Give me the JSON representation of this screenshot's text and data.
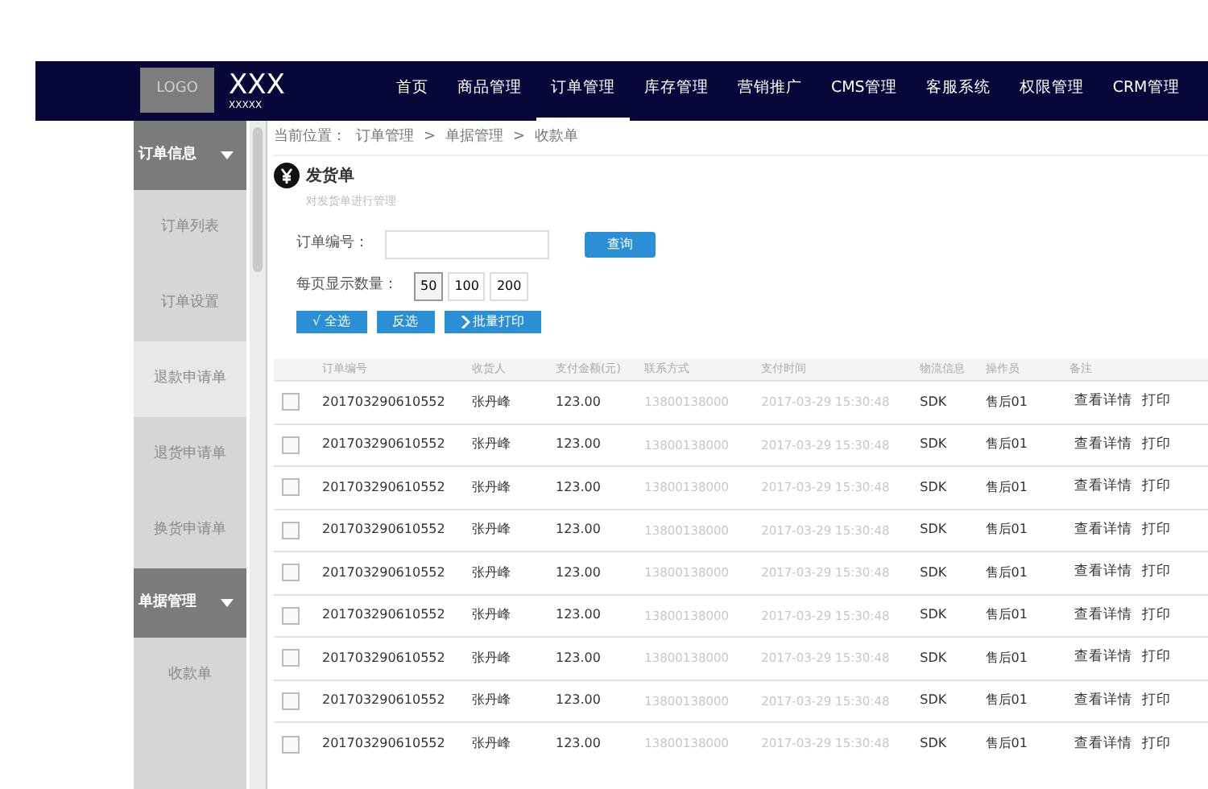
{
  "navbar": {
    "logo": "LOGO",
    "brand": "XXX",
    "brand_sub": "XXXXX",
    "items": [
      {
        "label": "首页",
        "selected": false
      },
      {
        "label": "商品管理",
        "selected": false
      },
      {
        "label": "订单管理",
        "selected": true
      },
      {
        "label": "库存管理",
        "selected": false
      },
      {
        "label": "营销推广",
        "selected": false
      },
      {
        "label": "CMS管理",
        "selected": false
      },
      {
        "label": "客服系统",
        "selected": false
      },
      {
        "label": "权限管理",
        "selected": false
      },
      {
        "label": "CRM管理",
        "selected": false
      }
    ]
  },
  "sidebar": {
    "sections": [
      {
        "label": "订单信息",
        "expanded": true,
        "items": [
          {
            "label": "订单列表",
            "selected": false
          },
          {
            "label": "订单设置",
            "selected": false
          },
          {
            "label": "退款申请单",
            "selected": true
          },
          {
            "label": "退货申请单",
            "selected": false
          },
          {
            "label": "换货申请单",
            "selected": false
          }
        ]
      },
      {
        "label": "单据管理",
        "expanded": true,
        "items": [
          {
            "label": "收款单",
            "selected": false
          }
        ]
      }
    ]
  },
  "breadcrumb": {
    "prefix": "当前位置：",
    "separator": ">",
    "items": [
      "订单管理",
      "单据管理",
      "收款单"
    ]
  },
  "page": {
    "title": "发货单",
    "subtitle": "对发货单进行管理"
  },
  "filters": {
    "order_label": "订单编号：",
    "query_button": "查询",
    "per_page_label": "每页显示数量：",
    "per_page": [
      {
        "label": "50",
        "selected": true
      },
      {
        "label": "100",
        "selected": false
      },
      {
        "label": "200",
        "selected": false
      }
    ]
  },
  "actions": [
    {
      "label": "√ 全选",
      "kind": "plain"
    },
    {
      "label": "反选",
      "kind": "plain"
    },
    {
      "label": "批量打印",
      "kind": "print"
    }
  ],
  "table": {
    "columns": [
      "订单编号",
      "收货人",
      "支付金额(元)",
      "联系方式",
      "支付时间",
      "物流信息",
      "操作员",
      "备注"
    ],
    "rows": [
      {
        "checked": false,
        "cells": [
          "201703290610552",
          "张丹峰",
          "123.00",
          "13800138000",
          "2017-03-29 15:30:48",
          "SDK",
          "售后01"
        ],
        "actions": [
          "查看详情",
          "打印"
        ]
      },
      {
        "checked": false,
        "cells": [
          "201703290610552",
          "张丹峰",
          "123.00",
          "13800138000",
          "2017-03-29 15:30:48",
          "SDK",
          "售后01"
        ],
        "actions": [
          "查看详情",
          "打印"
        ]
      },
      {
        "checked": false,
        "cells": [
          "201703290610552",
          "张丹峰",
          "123.00",
          "13800138000",
          "2017-03-29 15:30:48",
          "SDK",
          "售后01"
        ],
        "actions": [
          "查看详情",
          "打印"
        ]
      },
      {
        "checked": false,
        "cells": [
          "201703290610552",
          "张丹峰",
          "123.00",
          "13800138000",
          "2017-03-29 15:30:48",
          "SDK",
          "售后01"
        ],
        "actions": [
          "查看详情",
          "打印"
        ]
      },
      {
        "checked": false,
        "cells": [
          "201703290610552",
          "张丹峰",
          "123.00",
          "13800138000",
          "2017-03-29 15:30:48",
          "SDK",
          "售后01"
        ],
        "actions": [
          "查看详情",
          "打印"
        ]
      },
      {
        "checked": false,
        "cells": [
          "201703290610552",
          "张丹峰",
          "123.00",
          "13800138000",
          "2017-03-29 15:30:48",
          "SDK",
          "售后01"
        ],
        "actions": [
          "查看详情",
          "打印"
        ]
      },
      {
        "checked": false,
        "cells": [
          "201703290610552",
          "张丹峰",
          "123.00",
          "13800138000",
          "2017-03-29 15:30:48",
          "SDK",
          "售后01"
        ],
        "actions": [
          "查看详情",
          "打印"
        ]
      },
      {
        "checked": false,
        "cells": [
          "201703290610552",
          "张丹峰",
          "123.00",
          "13800138000",
          "2017-03-29 15:30:48",
          "SDK",
          "售后01"
        ],
        "actions": [
          "查看详情",
          "打印"
        ]
      },
      {
        "checked": false,
        "cells": [
          "201703290610552",
          "张丹峰",
          "123.00",
          "13800138000",
          "2017-03-29 15:30:48",
          "SDK",
          "售后01"
        ],
        "actions": [
          "查看详情",
          "打印"
        ]
      }
    ]
  }
}
